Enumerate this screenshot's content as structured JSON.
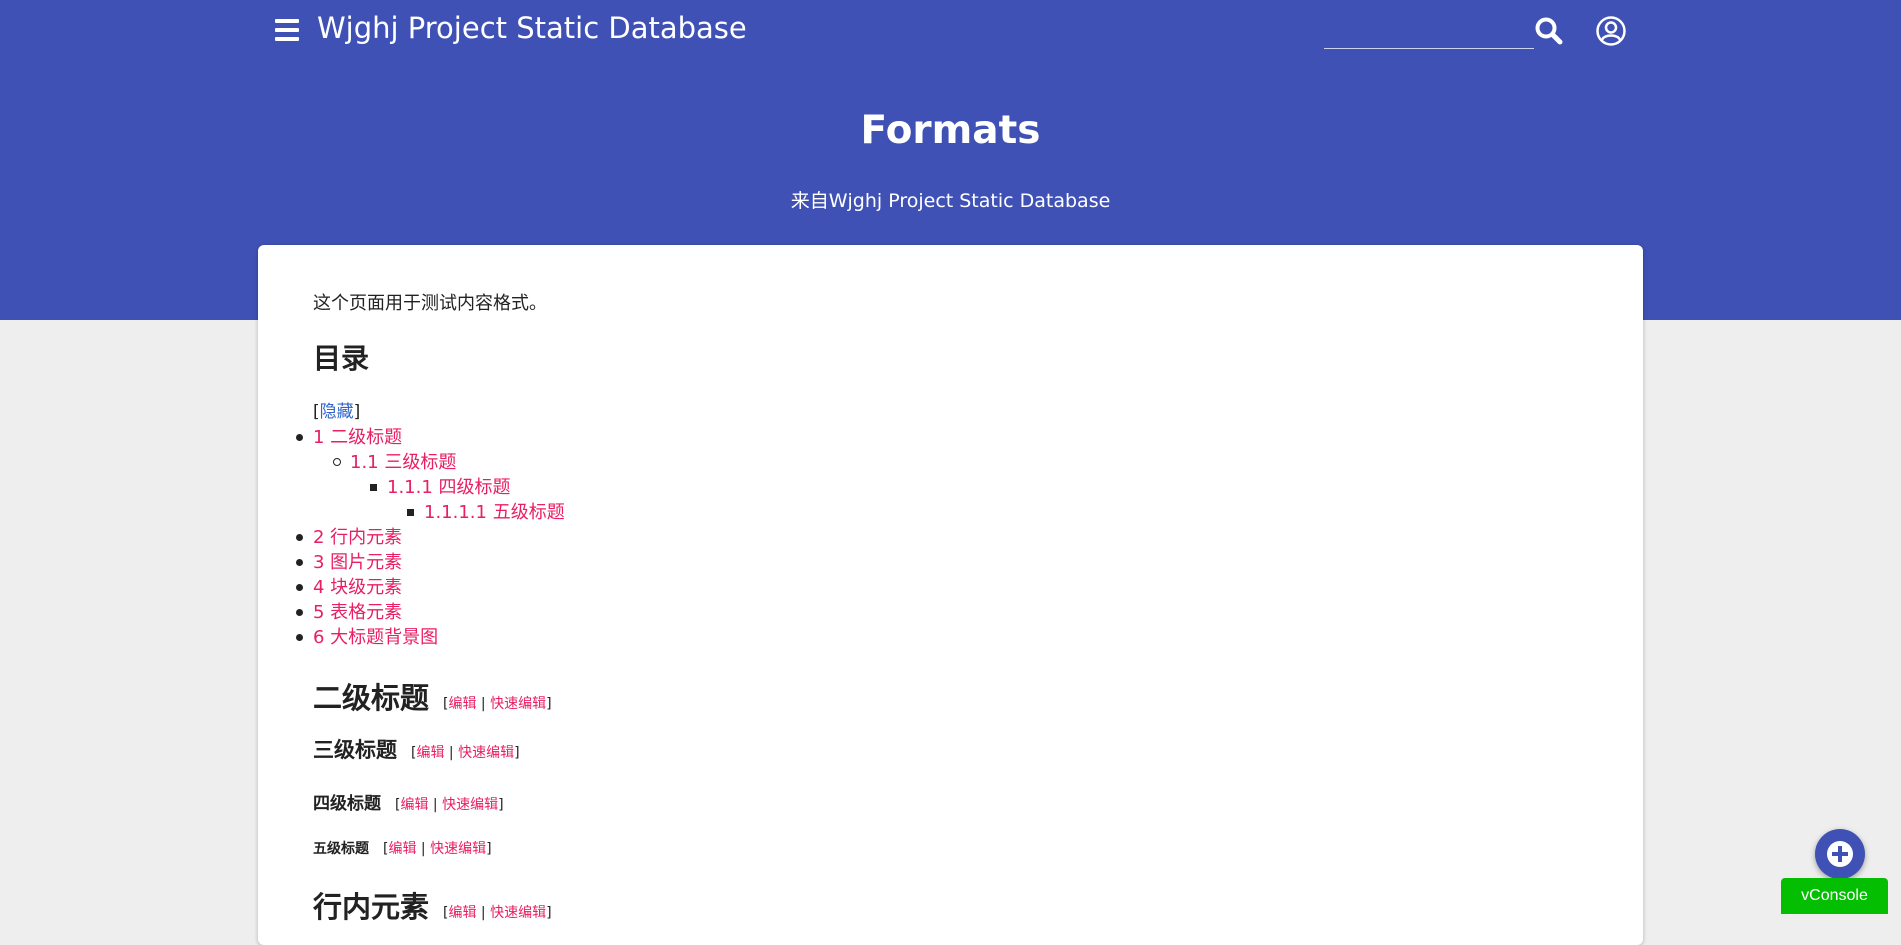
{
  "header": {
    "site_title": "Wjghj Project Static Database",
    "search_placeholder": "",
    "page_title": "Formats",
    "page_subtitle": "来自Wjghj Project Static Database"
  },
  "content": {
    "intro": "这个页面用于测试内容格式。",
    "toc": {
      "title": "目录",
      "toggle_open": "[",
      "toggle_label": "隐藏",
      "toggle_close": "]",
      "items": [
        {
          "label": "1 二级标题",
          "level": 1
        },
        {
          "label": "1.1 三级标题",
          "level": 2
        },
        {
          "label": "1.1.1 四级标题",
          "level": 3
        },
        {
          "label": "1.1.1.1 五级标题",
          "level": 4
        },
        {
          "label": "2 行内元素",
          "level": 1
        },
        {
          "label": "3 图片元素",
          "level": 1
        },
        {
          "label": "4 块级元素",
          "level": 1
        },
        {
          "label": "5 表格元素",
          "level": 1
        },
        {
          "label": "6 大标题背景图",
          "level": 1
        }
      ]
    },
    "edit_label": "编辑",
    "quick_edit_label": "快速编辑",
    "bracket_open": "[",
    "separator": " | ",
    "bracket_close": "]",
    "headings": [
      {
        "text": "二级标题",
        "level": 2
      },
      {
        "text": "三级标题",
        "level": 3
      },
      {
        "text": "四级标题",
        "level": 4
      },
      {
        "text": "五级标题",
        "level": 5
      },
      {
        "text": "行内元素",
        "level": 2
      }
    ]
  },
  "floating": {
    "vconsole_label": "vConsole"
  },
  "colors": {
    "header_bg": "#3f51b5",
    "link": "#e91e63",
    "toc_toggle_link": "#3366cc",
    "vconsole_bg": "#04be02"
  },
  "icons": {
    "menu": "hamburger-icon",
    "search": "search-icon",
    "user": "user-circle-icon",
    "fab": "plus-icon"
  }
}
